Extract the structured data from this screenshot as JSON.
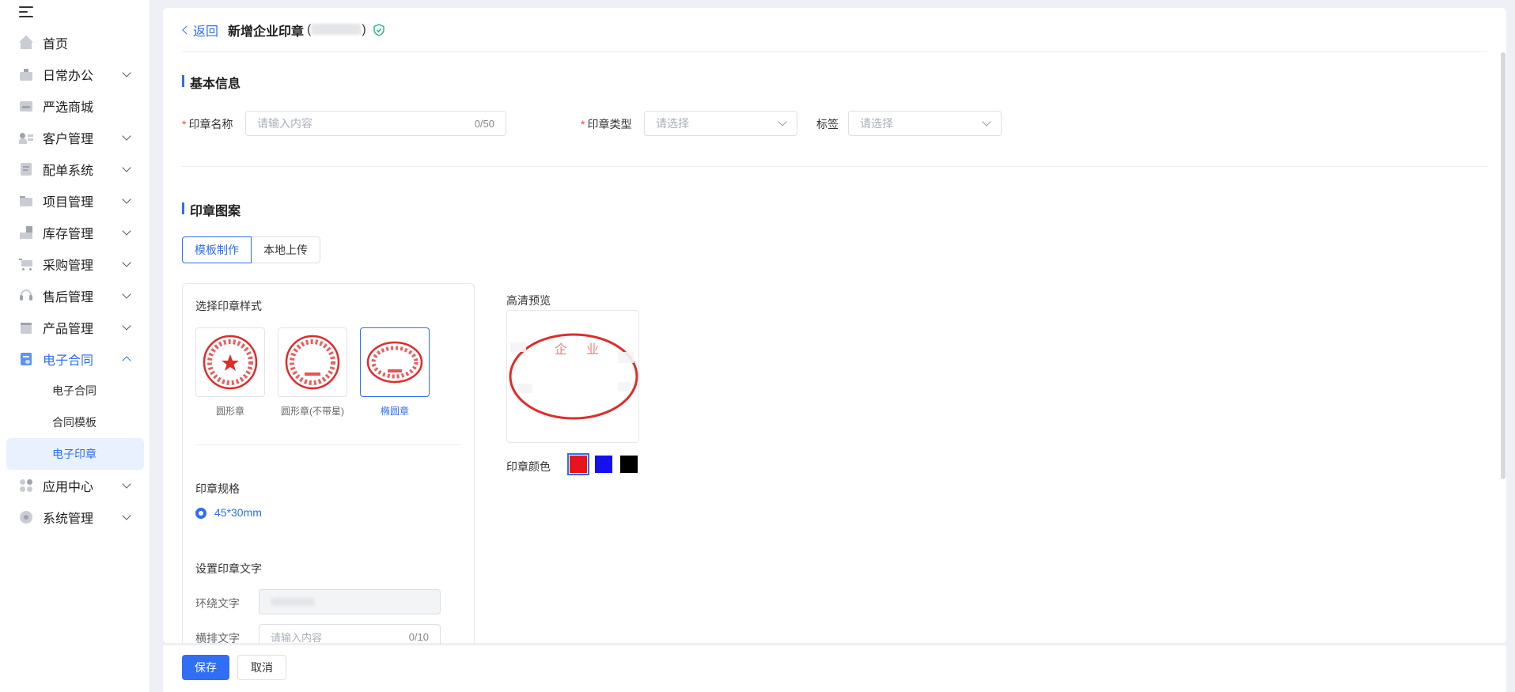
{
  "sidebar": {
    "items": [
      {
        "label": "首页",
        "icon": "home-icon"
      },
      {
        "label": "日常办公",
        "icon": "briefcase-icon"
      },
      {
        "label": "严选商城",
        "icon": "image-icon"
      },
      {
        "label": "客户管理",
        "icon": "user-card-icon"
      },
      {
        "label": "配单系统",
        "icon": "document-icon"
      },
      {
        "label": "项目管理",
        "icon": "folder-icon"
      },
      {
        "label": "库存管理",
        "icon": "boxes-icon"
      },
      {
        "label": "采购管理",
        "icon": "cart-icon"
      },
      {
        "label": "售后管理",
        "icon": "headset-icon"
      },
      {
        "label": "产品管理",
        "icon": "package-icon"
      },
      {
        "label": "电子合同",
        "icon": "contract-icon"
      },
      {
        "label": "应用中心",
        "icon": "apps-icon"
      },
      {
        "label": "系统管理",
        "icon": "settings-icon"
      }
    ],
    "sub_items": [
      "电子合同",
      "合同模板",
      "电子印章"
    ]
  },
  "header": {
    "back": "返回",
    "title": "新增企业印章",
    "paren_open": "(",
    "paren_close": ")"
  },
  "basic": {
    "title": "基本信息",
    "name_label": "印章名称",
    "name_placeholder": "请输入内容",
    "name_count": "0/50",
    "type_label": "印章类型",
    "type_placeholder": "请选择",
    "tag_label": "标签",
    "tag_placeholder": "请选择"
  },
  "pattern": {
    "title": "印章图案",
    "tabs": [
      "模板制作",
      "本地上传"
    ],
    "choose_style": "选择印章样式",
    "styles": [
      "圆形章",
      "圆形章(不带星)",
      "椭圆章"
    ],
    "spec_label": "印章规格",
    "spec_value": "45*30mm",
    "text_label": "设置印章文字",
    "ring_label": "环绕文字",
    "horiz_label": "横排文字",
    "horiz_placeholder": "请输入内容",
    "horiz_count": "0/10",
    "preview_title": "高清预览",
    "preview_chars": [
      "企",
      "业"
    ],
    "color_label": "印章颜色",
    "colors": [
      "#e8141c",
      "#1410f0",
      "#000000"
    ]
  },
  "footer": {
    "save": "保存",
    "cancel": "取消"
  }
}
